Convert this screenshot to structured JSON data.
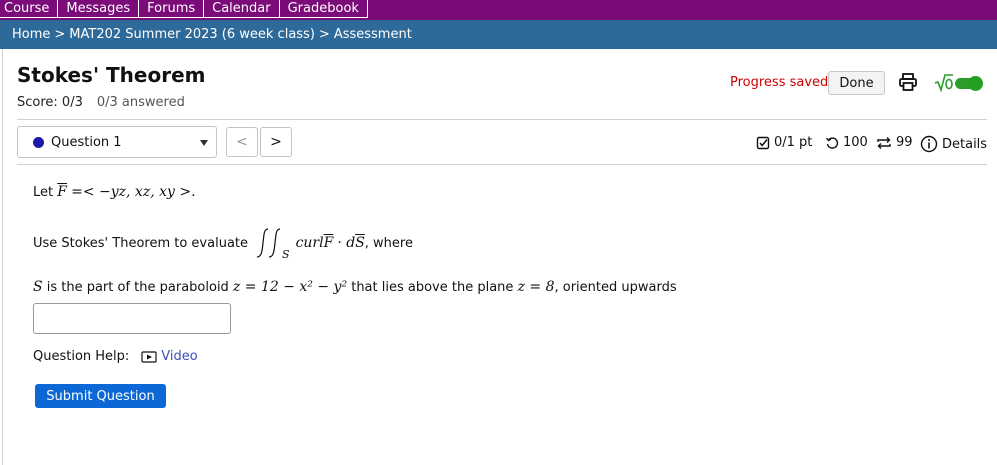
{
  "topnav": {
    "items": [
      "Course",
      "Messages",
      "Forums",
      "Calendar",
      "Gradebook"
    ]
  },
  "breadcrumb": {
    "items": [
      "Home",
      "MAT202 Summer 2023 (6 week class)",
      "Assessment"
    ],
    "separator": ">"
  },
  "assessment": {
    "title": "Stokes' Theorem",
    "score": "Score: 0/3",
    "answered": "0/3 answered",
    "progress_saved": "Progress saved",
    "done_label": "Done"
  },
  "question_nav": {
    "selected": "Question 1",
    "prev": "<",
    "next": ">",
    "points": "0/1 pt",
    "retries": "100",
    "attempts": "99",
    "details": "Details"
  },
  "question": {
    "line1_prefix": "Let",
    "line1_vec": "F",
    "line1_eq": "=< −yz, xz, xy >.",
    "line2_prefix": "Use Stokes' Theorem to evaluate",
    "line2_integrand": "curl",
    "line2_vec": "F",
    "line2_dot": "· d",
    "line2_ds": "S",
    "line2_subscript": "S",
    "line2_suffix": ", where",
    "line3_s": "S",
    "line3_text1": "is the part of the paraboloid",
    "line3_eq": "z = 12 − x² − y²",
    "line3_text2": "that lies above the plane",
    "line3_plane": "z = 8",
    "line3_text3": ", oriented upwards",
    "answer_value": ""
  },
  "help": {
    "label": "Question Help:",
    "video_label": "Video"
  },
  "submit_label": "Submit Question",
  "colors": {
    "topnav": "#7b0b78",
    "breadcrumb": "#2e6a99",
    "submit": "#0b68d6",
    "progress": "#cc0000"
  }
}
